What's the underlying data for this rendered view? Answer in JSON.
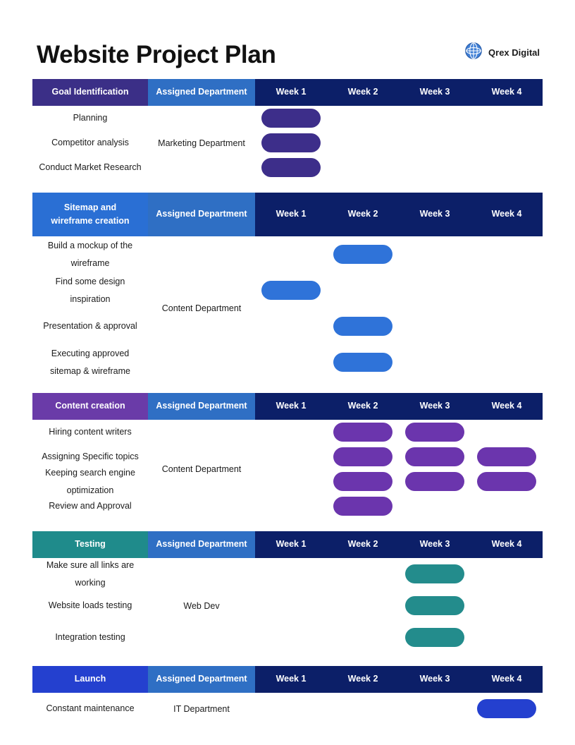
{
  "header": {
    "title": "Website Project Plan",
    "brand_name": "Qrex Digital",
    "brand_icon": "globe-icon"
  },
  "colors": {
    "header_dept": "#2f6fc4",
    "header_weeks": "#0c1f68",
    "section1_header": "#3b2f87",
    "section1_bar": "#3d2e8a",
    "section2_header": "#2a6fd4",
    "section2_bar": "#2f73d9",
    "section3_header": "#6a3ba8",
    "section3_bar": "#6b35ad",
    "section4_header": "#1f8b8b",
    "section4_bar": "#238c8c",
    "section5_header": "#2440cf",
    "section5_bar": "#2440cf",
    "text_dark": "#1b1b1b",
    "page_background": "#ffffff"
  },
  "column_headers": {
    "department": "Assigned Department",
    "weeks": [
      "Week 1",
      "Week 2",
      "Week 3",
      "Week 4"
    ]
  },
  "chart_data": {
    "type": "bar",
    "title": "Website Project Plan",
    "categories": [
      "Week 1",
      "Week 2",
      "Week 3",
      "Week 4"
    ],
    "grid": false,
    "legend": "none",
    "sections": [
      {
        "name": "Goal Identification",
        "department": "Marketing Department",
        "tasks": [
          {
            "label": "Planning",
            "weeks": [
              1,
              0,
              0,
              0
            ]
          },
          {
            "label": "Competitor analysis",
            "weeks": [
              1,
              0,
              0,
              0
            ]
          },
          {
            "label": "Conduct Market Research",
            "weeks": [
              1,
              0,
              0,
              0
            ]
          }
        ]
      },
      {
        "name": "Sitemap and wireframe creation",
        "department": "Content Department",
        "tasks": [
          {
            "label": "Build a mockup of the wireframe",
            "weeks": [
              0,
              1,
              0,
              0
            ]
          },
          {
            "label": "Find some design inspiration",
            "weeks": [
              1,
              0,
              0,
              0
            ]
          },
          {
            "label": "Presentation & approval",
            "weeks": [
              0,
              1,
              0,
              0
            ]
          },
          {
            "label": "Executing approved sitemap & wireframe",
            "weeks": [
              0,
              1,
              0,
              0
            ]
          }
        ]
      },
      {
        "name": "Content creation",
        "department": "Content Department",
        "tasks": [
          {
            "label": "Hiring content writers",
            "weeks": [
              0,
              1,
              1,
              0
            ]
          },
          {
            "label": "Assigning Specific topics",
            "weeks": [
              0,
              1,
              1,
              1
            ]
          },
          {
            "label": "Keeping search engine optimization",
            "weeks": [
              0,
              1,
              1,
              1
            ]
          },
          {
            "label": "Review and Approval",
            "weeks": [
              0,
              1,
              0,
              0
            ]
          }
        ]
      },
      {
        "name": "Testing",
        "department": "Web Dev",
        "tasks": [
          {
            "label": "Make sure all links are working",
            "weeks": [
              0,
              0,
              1,
              0
            ]
          },
          {
            "label": "Website loads testing",
            "weeks": [
              0,
              0,
              1,
              0
            ]
          },
          {
            "label": "Integration testing",
            "weeks": [
              0,
              0,
              1,
              0
            ]
          }
        ]
      },
      {
        "name": "Launch",
        "department": "IT Department",
        "tasks": [
          {
            "label": "Constant maintenance",
            "weeks": [
              0,
              0,
              0,
              1
            ]
          }
        ]
      }
    ]
  }
}
